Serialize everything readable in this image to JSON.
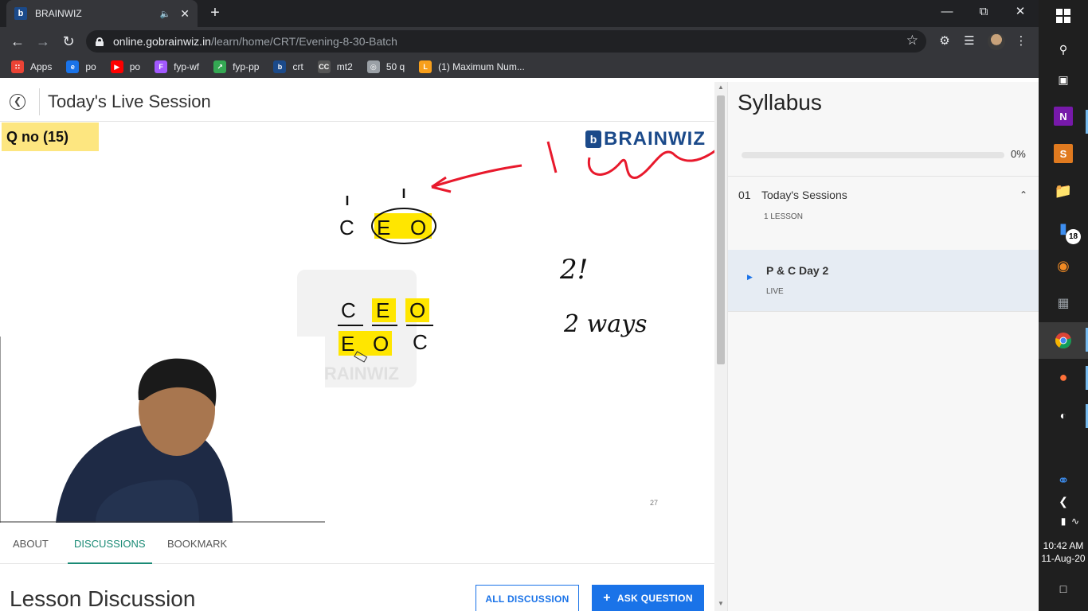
{
  "browser": {
    "tab_title": "BRAINWIZ",
    "favicon_letter": "b",
    "url_host": "online.gobrainwiz.in",
    "url_path": "/learn/home/CRT/Evening-8-30-Batch",
    "bookmarks": [
      {
        "label": "Apps",
        "icon": "apps-grid-icon",
        "color": "#ea4335"
      },
      {
        "label": "po",
        "icon": "e-icon",
        "color": "#1a73e8"
      },
      {
        "label": "po",
        "icon": "youtube-icon",
        "color": "#ff0000"
      },
      {
        "label": "fyp-wf",
        "icon": "figma-icon",
        "color": "#a259ff"
      },
      {
        "label": "fyp-pp",
        "icon": "chart-icon",
        "color": "#34a853"
      },
      {
        "label": "crt",
        "icon": "brainwiz-icon",
        "color": "#1b4a8a"
      },
      {
        "label": "mt2",
        "icon": "cc-icon",
        "color": "#555555"
      },
      {
        "label": "50 q",
        "icon": "globe-icon",
        "color": "#9aa0a6"
      },
      {
        "label": "(1) Maximum Num...",
        "icon": "leetcode-icon",
        "color": "#f89f1b"
      }
    ]
  },
  "page": {
    "title": "Today's Live Session"
  },
  "video": {
    "qno": "Q no (15)",
    "brand": "BRAINWIZ",
    "brand_letter": "b",
    "watermark": "BRAINWIZ",
    "slide_number": "27",
    "letters_top": [
      "C",
      "E",
      "O"
    ],
    "row1": [
      "C",
      "E",
      "O"
    ],
    "row2": [
      "E",
      "O",
      "C"
    ],
    "handwritten_1": "2!",
    "handwritten_2": "2 ways"
  },
  "tabs": [
    {
      "label": "ABOUT"
    },
    {
      "label": "DISCUSSIONS",
      "active": true
    },
    {
      "label": "BOOKMARK"
    }
  ],
  "discussion": {
    "heading": "Lesson Discussion",
    "all_button": "ALL DISCUSSION",
    "ask_button": "ASK QUESTION",
    "ask_icon": "+"
  },
  "syllabus": {
    "title": "Syllabus",
    "progress_percent": 0,
    "progress_text": "0%",
    "section_number": "01",
    "section_title": "Today's Sessions",
    "section_sub": "1 LESSON",
    "lesson_name": "P & C Day 2",
    "lesson_status": "LIVE"
  },
  "taskbar": {
    "time": "10:42 AM",
    "date": "11-Aug-20",
    "badge": "18"
  },
  "colors": {
    "accent_teal": "#1a8a75",
    "accent_blue": "#1a73e8",
    "highlight_yellow": "#ffe600",
    "annotation_red": "#e8192c",
    "brand_blue": "#1b4a8a"
  }
}
